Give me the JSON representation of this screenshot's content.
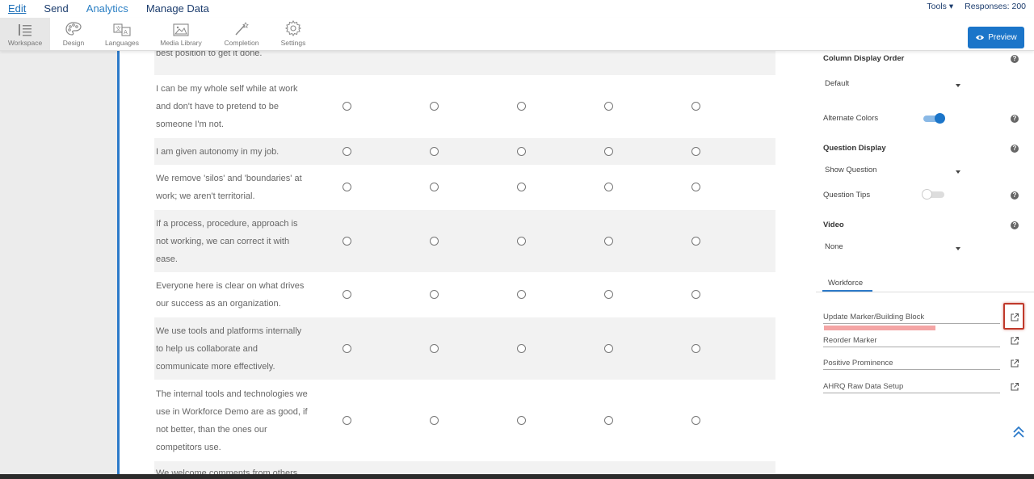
{
  "topnav": {
    "items": [
      "Edit",
      "Send",
      "Analytics",
      "Manage Data"
    ],
    "tools": "Tools ▾",
    "responses": "Responses: 200"
  },
  "toolbar": {
    "items": [
      {
        "label": "Workspace",
        "icon": "workspace-icon"
      },
      {
        "label": "Design",
        "icon": "palette-icon"
      },
      {
        "label": "Languages",
        "icon": "languages-icon"
      },
      {
        "label": "Media Library",
        "icon": "image-icon"
      },
      {
        "label": "Completion",
        "icon": "magic-wand-icon"
      },
      {
        "label": "Settings",
        "icon": "gear-icon"
      }
    ],
    "preview": "Preview"
  },
  "survey": {
    "rows": [
      {
        "lines": [
          "best position to get it done."
        ]
      },
      {
        "lines": [
          "I can be my whole self while at work",
          "and don't have to pretend to be",
          "someone I'm not."
        ]
      },
      {
        "lines": [
          "I am given autonomy in my job."
        ]
      },
      {
        "lines": [
          "We remove 'silos' and 'boundaries' at",
          "work; we aren't territorial."
        ]
      },
      {
        "lines": [
          "If a process, procedure, approach is",
          "not working, we can correct it with",
          "ease."
        ]
      },
      {
        "lines": [
          "Everyone here is clear on what drives",
          "our success as an organization."
        ]
      },
      {
        "lines": [
          "We use tools and platforms internally",
          "to help us collaborate and",
          "communicate more effectively."
        ]
      },
      {
        "lines": [
          "The internal tools and technologies we",
          "use in Workforce Demo are as good, if",
          "not better, than the ones our",
          "competitors use."
        ]
      },
      {
        "lines": [
          "We welcome comments from others"
        ]
      }
    ]
  },
  "settings": {
    "column_display_order_label": "Column Display Order",
    "column_display_order_value": "Default",
    "alternate_colors_label": "Alternate Colors",
    "alternate_colors_on": true,
    "question_display_label": "Question Display",
    "question_display_value": "Show Question",
    "question_tips_label": "Question Tips",
    "question_tips_on": false,
    "video_label": "Video",
    "video_value": "None",
    "help_glyph": "?",
    "tab": "Workforce",
    "links": [
      "Update Marker/Building Block",
      "Reorder Marker",
      "Positive Prominence",
      "AHRQ Raw Data Setup"
    ],
    "accent": "#2c7ac9",
    "highlight": "#c0392b"
  }
}
